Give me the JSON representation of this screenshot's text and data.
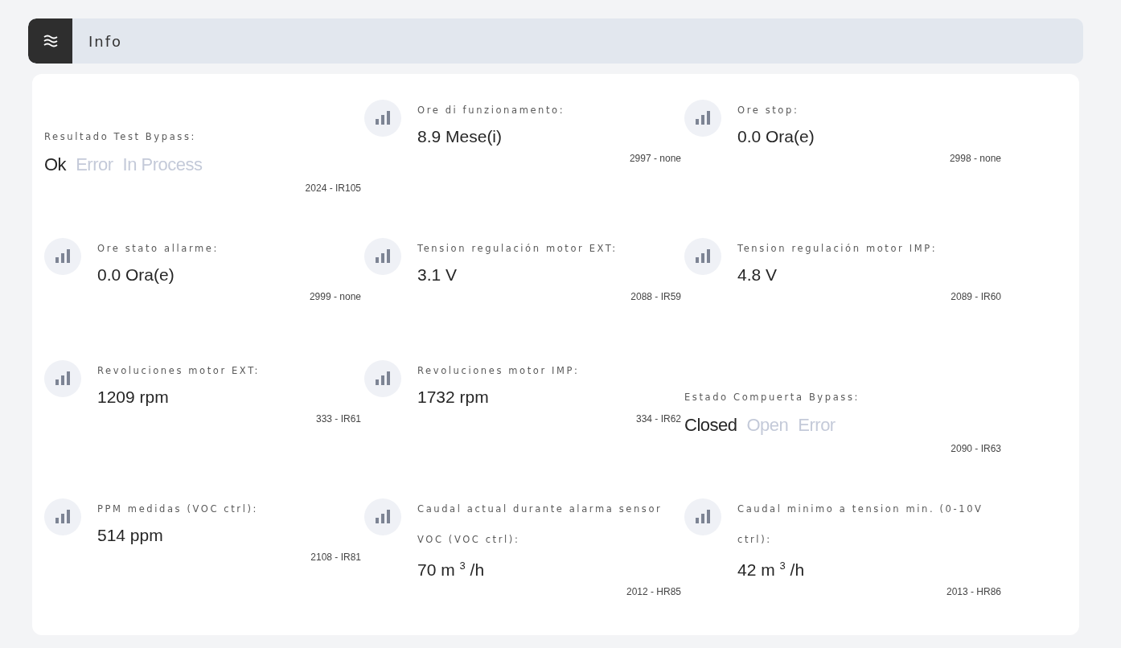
{
  "header": {
    "title": "Info"
  },
  "rows": [
    [
      {
        "kind": "status",
        "label": "Resultado Test Bypass:",
        "options": [
          {
            "label": "Ok",
            "selected": true
          },
          {
            "label": "Error",
            "selected": false
          },
          {
            "label": "In Process",
            "selected": false
          }
        ],
        "code": "2024 - IR105"
      },
      {
        "kind": "reading",
        "label": "Ore di funzionamento:",
        "value": "8.9 Mese(i)",
        "code": "2997 - none"
      },
      {
        "kind": "reading",
        "label": "Ore stop:",
        "value": "0.0 Ora(e)",
        "code": "2998 - none"
      }
    ],
    [
      {
        "kind": "reading",
        "label": "Ore stato allarme:",
        "value": "0.0 Ora(e)",
        "code": "2999 - none"
      },
      {
        "kind": "reading",
        "label": "Tension regulación motor EXT:",
        "value": "3.1 V",
        "code": "2088 - IR59"
      },
      {
        "kind": "reading",
        "label": "Tension regulación motor IMP:",
        "value": "4.8 V",
        "code": "2089 - IR60"
      }
    ],
    [
      {
        "kind": "reading",
        "label": "Revoluciones motor EXT:",
        "value": "1209 rpm",
        "code": "333 - IR61"
      },
      {
        "kind": "reading",
        "label": "Revoluciones motor IMP:",
        "value": "1732 rpm",
        "code": "334 - IR62"
      },
      {
        "kind": "status",
        "label": "Estado Compuerta Bypass:",
        "options": [
          {
            "label": "Closed",
            "selected": true
          },
          {
            "label": "Open",
            "selected": false
          },
          {
            "label": "Error",
            "selected": false
          }
        ],
        "code": "2090 - IR63"
      }
    ],
    [
      {
        "kind": "reading",
        "label": "PPM medidas (VOC ctrl):",
        "value": "514 ppm",
        "code": "2108 - IR81"
      },
      {
        "kind": "reading",
        "label": "Caudal actual durante alarma sensor VOC (VOC ctrl):",
        "value": "70 m $^{3}$ /h",
        "code": "2012 - HR85"
      },
      {
        "kind": "reading",
        "label": "Caudal minimo a tension min. (0-10V ctrl):",
        "value": "42 m $^{3}$ /h",
        "code": "2013 - HR86"
      }
    ]
  ]
}
